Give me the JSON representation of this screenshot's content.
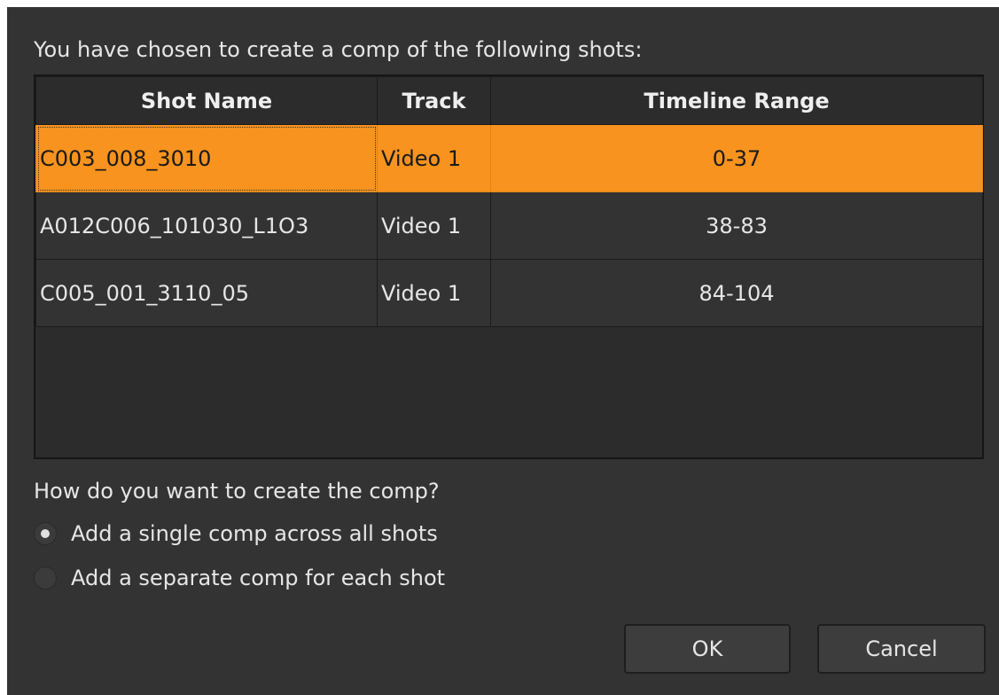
{
  "dialog": {
    "intro_text": "You have chosen to create a comp of the following shots:",
    "table": {
      "headers": [
        "Shot Name",
        "Track",
        "Timeline Range"
      ],
      "rows": [
        {
          "shot_name": "C003_008_3010",
          "track": "Video 1",
          "range": "0-37",
          "selected": true
        },
        {
          "shot_name": "A012C006_101030_L1O3",
          "track": "Video 1",
          "range": "38-83",
          "selected": false
        },
        {
          "shot_name": "C005_001_3110_05",
          "track": "Video 1",
          "range": "84-104",
          "selected": false
        }
      ]
    },
    "question": "How do you want to create the comp?",
    "options": [
      {
        "label": "Add a single comp across all shots",
        "checked": true
      },
      {
        "label": "Add a separate comp for each shot",
        "checked": false
      }
    ],
    "buttons": {
      "ok": "OK",
      "cancel": "Cancel"
    }
  },
  "colors": {
    "background": "#333333",
    "selection": "#f7931e",
    "text": "#e6e6e6"
  }
}
